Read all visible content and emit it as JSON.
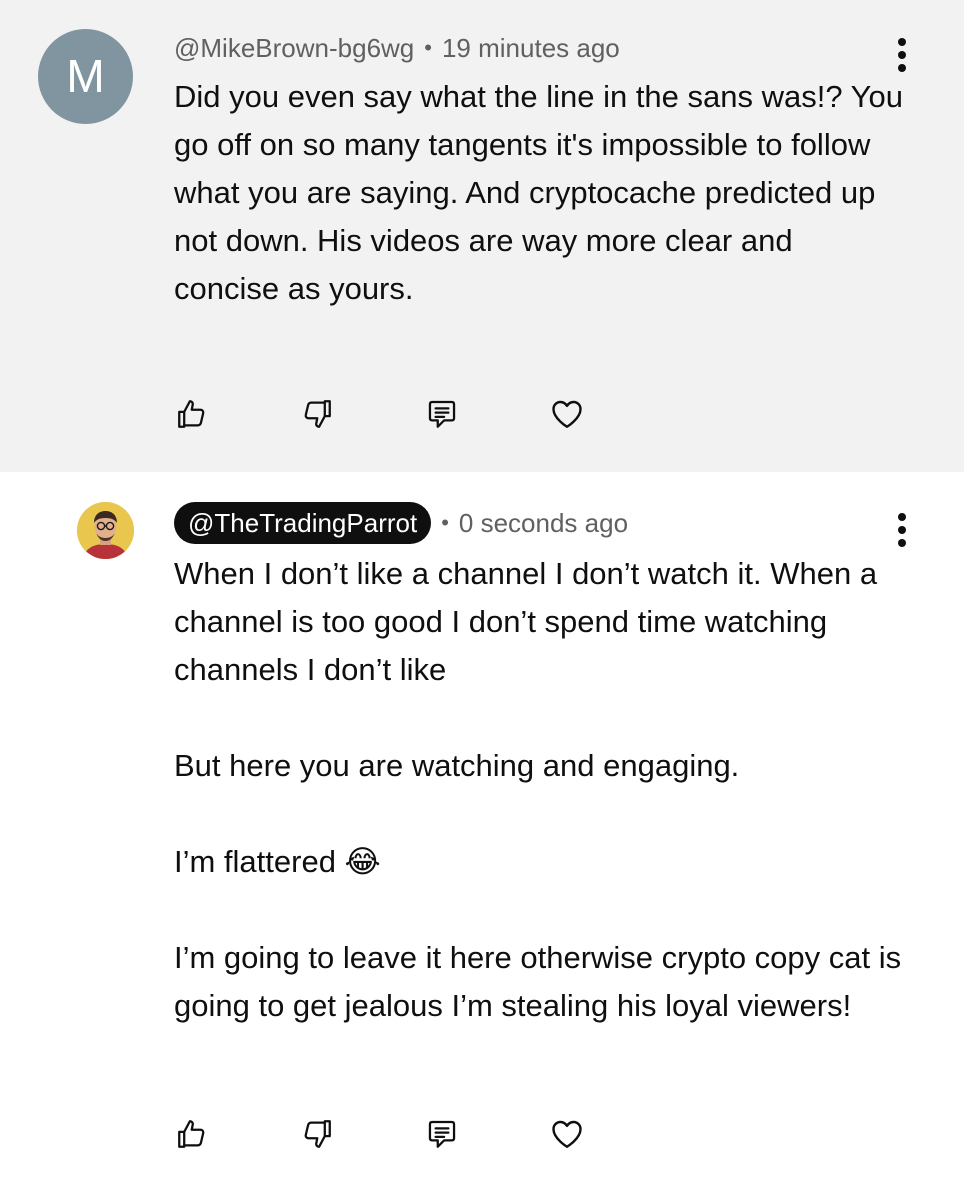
{
  "comments": [
    {
      "avatar_letter": "M",
      "author": "@MikeBrown-bg6wg",
      "separator": "•",
      "time": "19 minutes ago",
      "paragraphs": [
        "Did you even say what the line in the sans was!? You go off on so many tangents it's impossible to follow what you are saying. And cryptocache predicted up not down. His videos are way more clear and concise as yours."
      ],
      "highlighted": true
    },
    {
      "avatar": "profile-photo",
      "author": "@TheTradingParrot",
      "separator": "•",
      "time": "0 seconds ago",
      "paragraphs": [
        "When I don’t like a channel I don’t watch it. When a channel is too good I don’t spend time watching channels I don’t like",
        "But here you are watching and engaging.",
        "I’m flattered 😂",
        "I’m going to leave it here otherwise crypto copy cat is going to get jealous I’m stealing his loyal viewers!"
      ],
      "author_is_creator": true
    }
  ],
  "actions": [
    "thumbs-up-icon",
    "thumbs-down-icon",
    "reply-icon",
    "heart-icon"
  ],
  "colors": {
    "highlight_bg": "#f2f2f2",
    "avatar_bg": "#80959f",
    "creator_chip_bg": "#0f0f0f",
    "meta_text": "#606060"
  }
}
